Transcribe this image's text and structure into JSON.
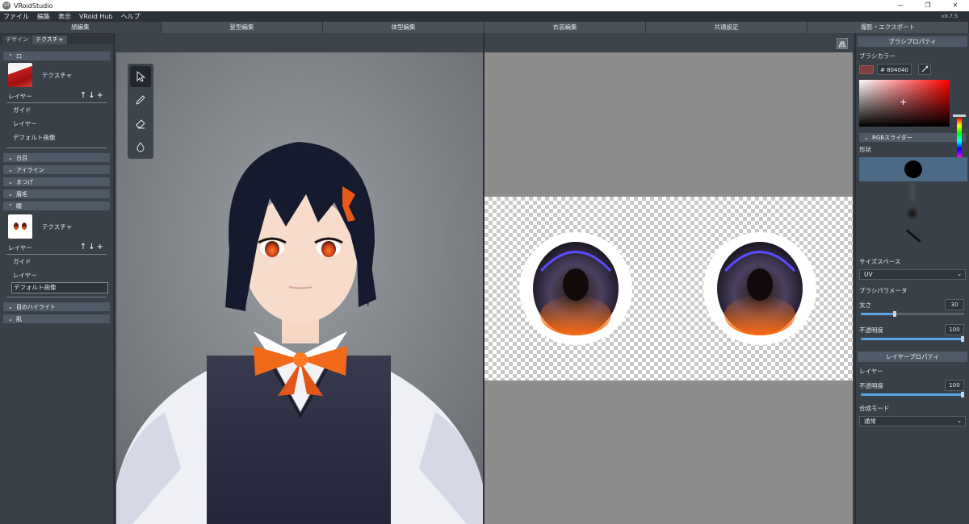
{
  "window": {
    "title": "VRoidStudio",
    "app_icon": "VR",
    "minimize": "—",
    "restore": "❐",
    "close": "✕"
  },
  "menu": {
    "items": [
      "ファイル",
      "編集",
      "表示",
      "VRoid Hub",
      "ヘルプ"
    ],
    "version": "v0.7.5"
  },
  "mode_tabs": [
    "顔編集",
    "髪型編集",
    "体型編集",
    "衣装編集",
    "共通設定",
    "撮影・エクスポート"
  ],
  "left_panel": {
    "tabs": [
      "デザイン",
      "テクスチャ"
    ],
    "sections": {
      "mouth": {
        "title": "口",
        "texture_label": "テクスチャ",
        "layer_title": "レイヤー",
        "layers": [
          "ガイド",
          "レイヤー",
          "デフォルト画像"
        ]
      },
      "collapsed_1": [
        "白目",
        "アイライン",
        "まつげ",
        "眉毛"
      ],
      "eye": {
        "title": "瞳",
        "texture_label": "テクスチャ",
        "layer_title": "レイヤー",
        "layers": [
          "ガイド",
          "レイヤー",
          "デフォルト画像"
        ]
      },
      "collapsed_2": [
        "目のハイライト",
        "肌"
      ]
    },
    "layer_icons": "↑↓+"
  },
  "right_panel": {
    "brush_props_title": "ブラシプロパティ",
    "brush_color_label": "ブラシカラー",
    "brush_color_hex": "# 804040",
    "brush_color": "#804040",
    "rgb_slider_label": "RGBスライダー",
    "shape_label": "形状",
    "size_space_label": "サイズスペース",
    "size_space_value": "UV",
    "brush_params_label": "ブラシパラメータ",
    "thickness_label": "太さ",
    "thickness_value": "30",
    "thickness_level": 0.33,
    "opacity_label": "不透明度",
    "opacity_value": "100",
    "opacity_level": 1.0,
    "layer_props_title": "レイヤープロパティ",
    "layer_label": "レイヤー",
    "layer_opacity_label": "不透明度",
    "layer_opacity_value": "100",
    "layer_opacity_level": 1.0,
    "blend_mode_label": "合成モード",
    "blend_mode_value": "通常"
  }
}
